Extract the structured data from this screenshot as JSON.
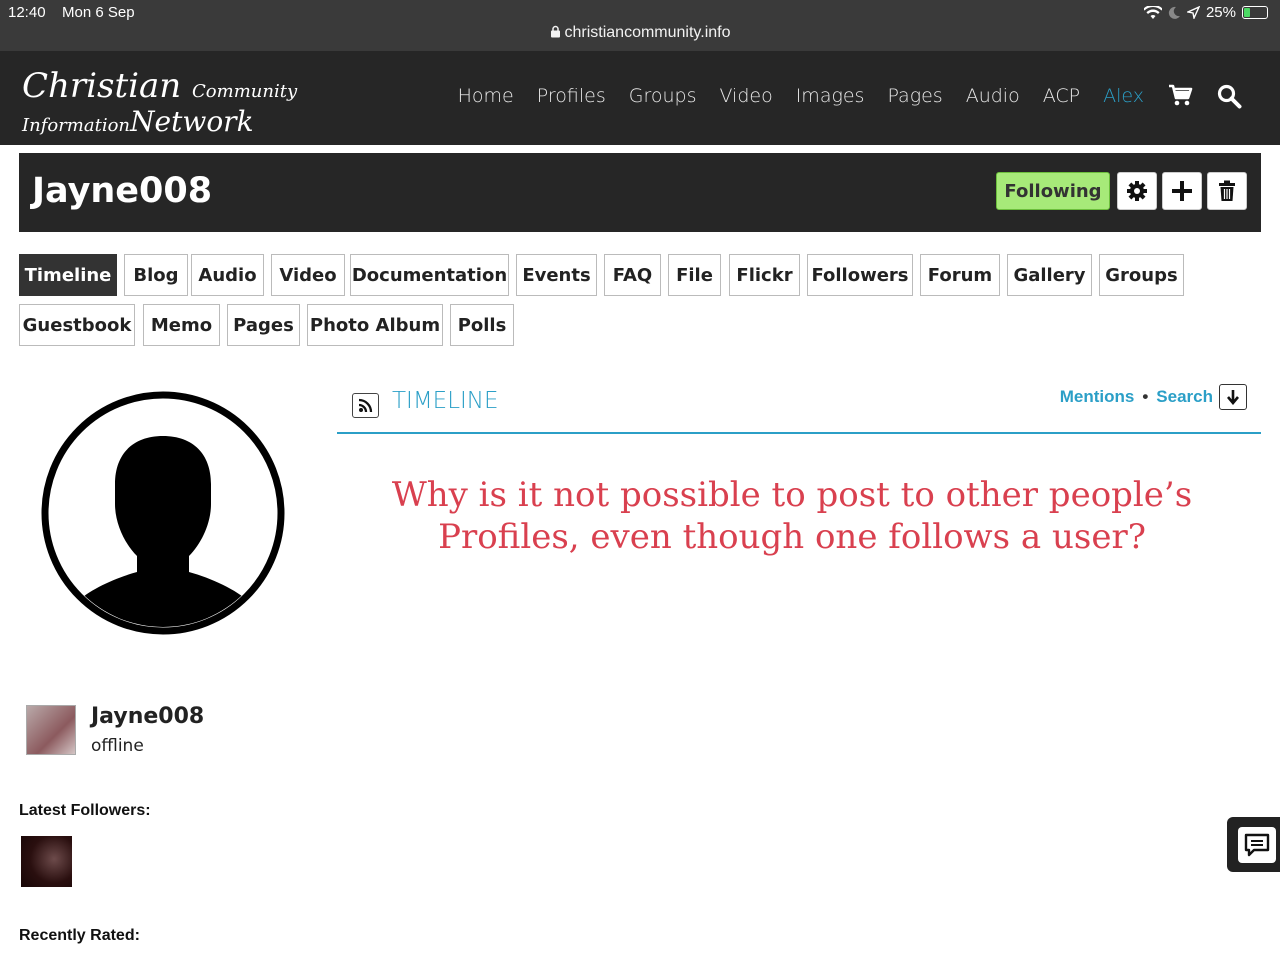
{
  "status_bar": {
    "time": "12:40",
    "date": "Mon 6 Sep",
    "battery": "25%",
    "url": "christiancommunity.info"
  },
  "site": {
    "logo_line1_main": "Christian",
    "logo_line1_small": "Community",
    "logo_line2_small": "Information",
    "logo_line2_main": "Network",
    "nav": [
      "Home",
      "Profiles",
      "Groups",
      "Video",
      "Images",
      "Pages",
      "Audio",
      "ACP",
      "Alex"
    ],
    "accent_color": "#2b9fc7"
  },
  "profile": {
    "title": "Jayne008",
    "follow_label": "Following",
    "follow_color": "#a7ea79"
  },
  "tabs": [
    "Timeline",
    "Blog",
    "Audio",
    "Video",
    "Documentation",
    "Events",
    "FAQ",
    "File",
    "Flickr",
    "Followers",
    "Forum",
    "Gallery",
    "Groups",
    "Guestbook",
    "Memo",
    "Pages",
    "Photo Album",
    "Polls"
  ],
  "timeline": {
    "title": "TIMELINE",
    "mentions": "Mentions",
    "search": "Search",
    "question": "Why is it not possible to post to other people’s Profiles, even though one follows a user?",
    "question_color": "#d9404f"
  },
  "user_card": {
    "name": "Jayne008",
    "status": "offline"
  },
  "sidebar": {
    "latest_followers": "Latest Followers:",
    "recently_rated": "Recently Rated:"
  }
}
